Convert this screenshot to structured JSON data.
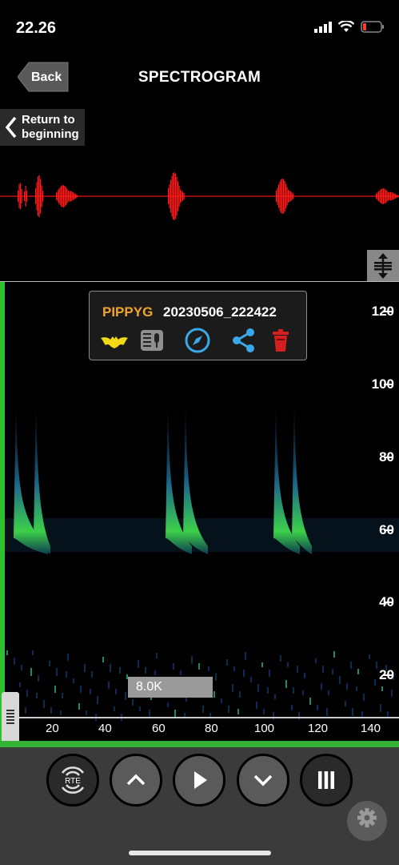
{
  "status_bar": {
    "time": "22.26"
  },
  "header": {
    "back_label": "Back",
    "title": "SPECTROGRAM",
    "return_label_1": "Return to",
    "return_label_2": "beginning"
  },
  "popup": {
    "species": "PIPPYG",
    "filename": "20230506_222422"
  },
  "spectrogram": {
    "y_ticks": [
      "120",
      "100",
      "80",
      "60",
      "40",
      "20"
    ],
    "x_ticks": [
      "20",
      "40",
      "60",
      "80",
      "100",
      "120",
      "140"
    ],
    "zoom_label": "8.0K"
  },
  "controls": {
    "rte_label": "RTE"
  },
  "colors": {
    "waveform": "#ff1a1a",
    "accent_green": "#2fbf2f",
    "species_label": "#f1a42b",
    "icon_blue": "#3aa8e8",
    "icon_red": "#d22020"
  }
}
